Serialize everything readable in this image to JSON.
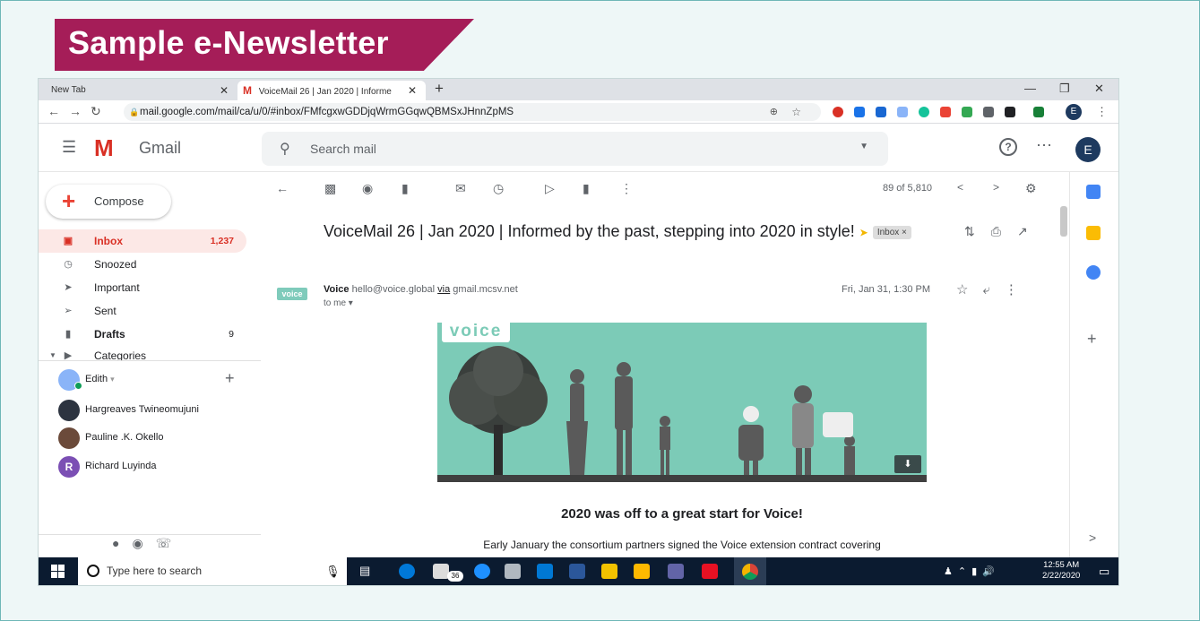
{
  "slide": {
    "title": "Sample e-Newsletter"
  },
  "browser": {
    "tabs": [
      {
        "label": "New Tab",
        "close": "✕"
      },
      {
        "label": "VoiceMail 26 | Jan 2020 | Informe",
        "close": "✕"
      }
    ],
    "new_tab": "+",
    "url": "mail.google.com/mail/ca/u/0/#inbox/FMfcgxwGDDjqWrmGGqwQBMSxJHnnZpMS",
    "profile_initial": "E",
    "colors": {
      "tab_bar": "#dee1e6",
      "omnibox": "#f1f3f4"
    }
  },
  "gmail": {
    "app_name": "Gmail",
    "search_placeholder": "Search mail",
    "avatar_initial": "E",
    "compose_label": "Compose",
    "nav": [
      {
        "label": "Inbox",
        "count": "1,237",
        "icon": "inbox-icon",
        "active": true
      },
      {
        "label": "Snoozed",
        "count": "",
        "icon": "clock-icon"
      },
      {
        "label": "Important",
        "count": "",
        "icon": "important-icon"
      },
      {
        "label": "Sent",
        "count": "",
        "icon": "send-icon"
      },
      {
        "label": "Drafts",
        "count": "9",
        "icon": "draft-icon"
      },
      {
        "label": "Categories",
        "count": "",
        "icon": "label-icon"
      }
    ],
    "hangouts": {
      "user": "Edith",
      "contacts": [
        {
          "name": "Hargreaves Twineomujuni"
        },
        {
          "name": "Pauline .K. Okello"
        },
        {
          "name": "Richard Luyinda",
          "initial": "R"
        }
      ]
    },
    "toolbar": {
      "page_count": "89 of 5,810"
    },
    "message": {
      "subject": "VoiceMail 26 | Jan 2020 | Informed by the past, stepping into 2020 in style!",
      "label": "Inbox",
      "sender_avatar": "voice",
      "sender_name": "Voice",
      "sender_email": "hello@voice.global",
      "via_word": "via",
      "via_domain": "gmail.mcsv.net",
      "to": "to me",
      "date": "Fri, Jan 31, 1:30 PM",
      "hero_logo": "voice",
      "headline": "2020 was off to a great start for Voice!",
      "body": "Early January the consortium partners signed the Voice extension contract covering"
    },
    "colors": {
      "accent_red": "#d93025",
      "inbox_bg": "#fce8e6",
      "hero_bg": "#7ccbb7"
    }
  },
  "taskbar": {
    "search_placeholder": "Type here to search",
    "badge": "36",
    "time": "12:55 AM",
    "date": "2/22/2020"
  }
}
